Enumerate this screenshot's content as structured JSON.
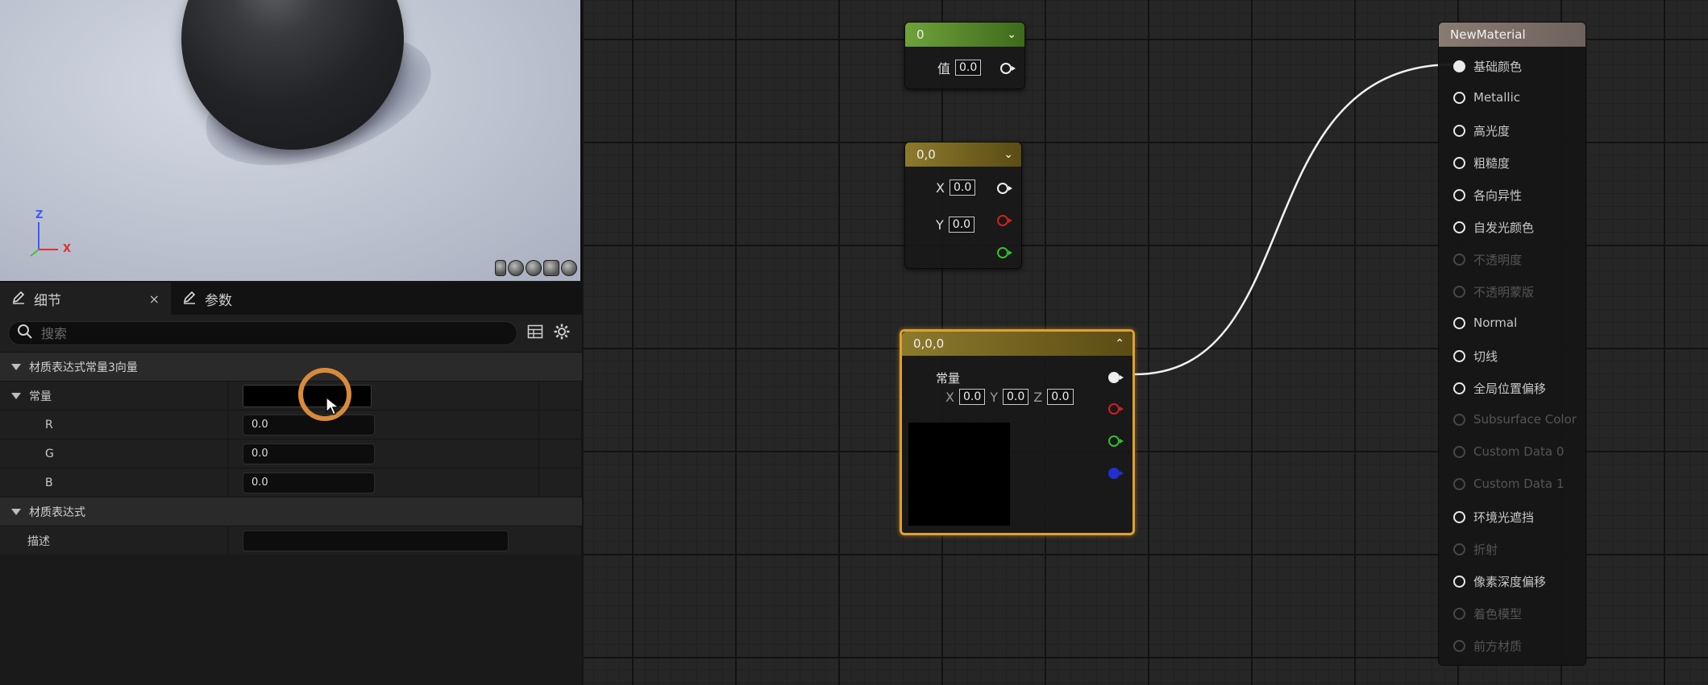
{
  "viewport": {
    "axis": {
      "z": "Z",
      "x": "X"
    }
  },
  "details": {
    "tabs": [
      {
        "label": "细节",
        "close": "×"
      },
      {
        "label": "参数"
      }
    ],
    "search": {
      "placeholder": "搜索"
    },
    "sections": {
      "vector3": {
        "title": "材质表达式常量3向量"
      },
      "constant": {
        "label": "常量",
        "color": "#000000"
      },
      "r": {
        "label": "R",
        "value": "0.0"
      },
      "g": {
        "label": "G",
        "value": "0.0"
      },
      "b": {
        "label": "B",
        "value": "0.0"
      },
      "expression": {
        "title": "材质表达式"
      },
      "desc": {
        "label": "描述",
        "value": ""
      }
    }
  },
  "graph": {
    "node_scalar": {
      "title": "0",
      "value_label": "值",
      "value": "0.0",
      "header_color": "#5f8f32"
    },
    "node_vec2": {
      "title": "0,0",
      "x_label": "X",
      "x": "0.0",
      "y_label": "Y",
      "y": "0.0",
      "header_color": "#7d6a22"
    },
    "node_vec3": {
      "title": "0,0,0",
      "label": "常量",
      "x_label": "X",
      "x": "0.0",
      "y_label": "Y",
      "y": "0.0",
      "z_label": "Z",
      "z": "0.0",
      "header_color": "#7a6a20",
      "preview_color": "#000000",
      "selected_border": "#e0a030"
    },
    "result": {
      "title": "NewMaterial",
      "pins": [
        {
          "label": "基础颜色",
          "enabled": true,
          "connected": true
        },
        {
          "label": "Metallic",
          "enabled": true
        },
        {
          "label": "高光度",
          "enabled": true
        },
        {
          "label": "粗糙度",
          "enabled": true
        },
        {
          "label": "各向异性",
          "enabled": true
        },
        {
          "label": "自发光颜色",
          "enabled": true
        },
        {
          "label": "不透明度",
          "enabled": false
        },
        {
          "label": "不透明蒙版",
          "enabled": false
        },
        {
          "label": "Normal",
          "enabled": true
        },
        {
          "label": "切线",
          "enabled": true
        },
        {
          "label": "全局位置偏移",
          "enabled": true
        },
        {
          "label": "Subsurface Color",
          "enabled": false
        },
        {
          "label": "Custom Data 0",
          "enabled": false
        },
        {
          "label": "Custom Data 1",
          "enabled": false
        },
        {
          "label": "环境光遮挡",
          "enabled": true
        },
        {
          "label": "折射",
          "enabled": false
        },
        {
          "label": "像素深度偏移",
          "enabled": true
        },
        {
          "label": "着色模型",
          "enabled": false
        },
        {
          "label": "前方材质",
          "enabled": false
        }
      ]
    }
  }
}
